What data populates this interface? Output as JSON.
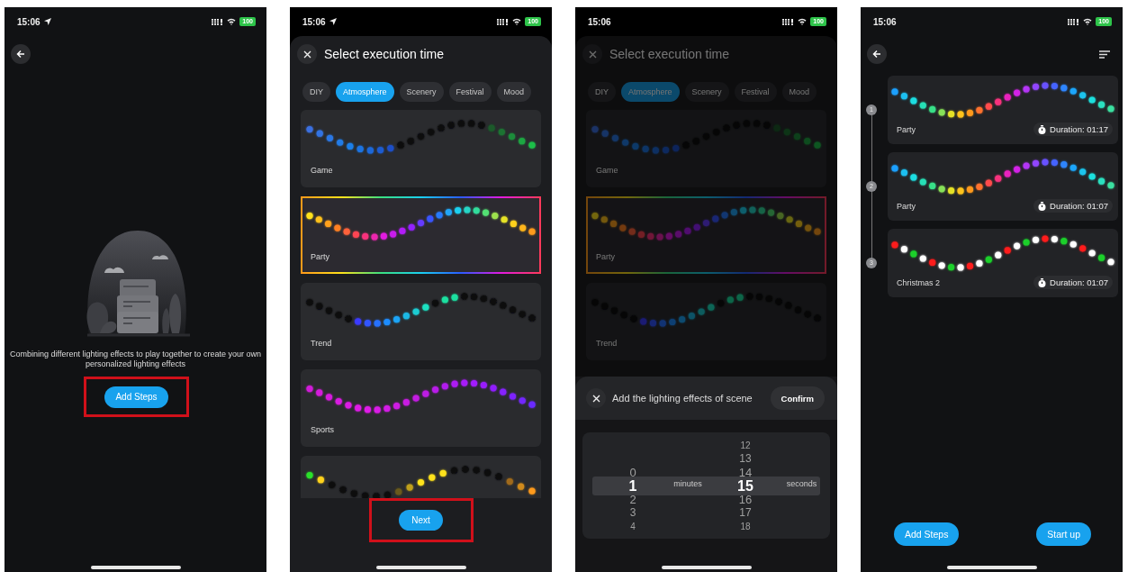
{
  "screens": [
    {
      "kind": "empty",
      "status_bar": {
        "time": "15:06",
        "location": true,
        "battery": "100"
      },
      "description": "Combining different lighting effects to play together to create your own personalized lighting effects",
      "add_button": "Add Steps",
      "highlighted": true
    },
    {
      "kind": "select",
      "status_bar": {
        "time": "15:06",
        "location": true,
        "battery": "100"
      },
      "dimmed": false,
      "sheet": {
        "title": "Select execution time",
        "categories": [
          {
            "label": "DIY",
            "selected": false
          },
          {
            "label": "Atmosphere",
            "selected": true
          },
          {
            "label": "Scenery",
            "selected": false
          },
          {
            "label": "Festival",
            "selected": false
          },
          {
            "label": "Mood",
            "selected": false
          }
        ],
        "effects": [
          {
            "name": "Game",
            "selected": false
          },
          {
            "name": "Party",
            "selected": true
          },
          {
            "name": "Trend",
            "selected": false
          },
          {
            "name": "Sports",
            "selected": false
          },
          {
            "selected": false
          }
        ]
      },
      "next_button": "Next",
      "highlighted": true
    },
    {
      "kind": "duration",
      "status_bar": {
        "time": "15:06",
        "location": false,
        "battery": "100"
      },
      "dimmed": true,
      "sheet": {
        "title": "Select execution time",
        "categories": [
          {
            "label": "DIY",
            "selected": false
          },
          {
            "label": "Atmosphere",
            "selected": true
          },
          {
            "label": "Scenery",
            "selected": false
          },
          {
            "label": "Festival",
            "selected": false
          },
          {
            "label": "Mood",
            "selected": false
          }
        ],
        "effects": [
          {
            "name": "Game",
            "selected": false
          },
          {
            "name": "Party",
            "selected": true
          },
          {
            "name": "Trend",
            "selected": false
          }
        ]
      },
      "dialog": {
        "title": "Add the lighting effects of scene",
        "confirm": "Confirm",
        "minutes_label": "minutes",
        "seconds_label": "seconds",
        "minutes": [
          {
            "value": "0",
            "selected": false
          },
          {
            "value": "1",
            "selected": true
          },
          {
            "value": "2",
            "selected": false
          },
          {
            "value": "3",
            "selected": false
          },
          {
            "value": "4",
            "selected": false
          }
        ],
        "seconds": [
          {
            "value": "12",
            "selected": false
          },
          {
            "value": "13",
            "selected": false
          },
          {
            "value": "14",
            "selected": false
          },
          {
            "value": "15",
            "selected": true
          },
          {
            "value": "16",
            "selected": false
          },
          {
            "value": "17",
            "selected": false
          },
          {
            "value": "18",
            "selected": false
          }
        ]
      }
    },
    {
      "kind": "steps",
      "status_bar": {
        "time": "15:06",
        "location": false,
        "battery": "100"
      },
      "steps": [
        {
          "number": "1",
          "name": "Party",
          "duration": "Duration: 01:17"
        },
        {
          "number": "2",
          "name": "Party",
          "duration": "Duration: 01:07"
        },
        {
          "number": "3",
          "name": "Christmas 2",
          "duration": "Duration: 01:07"
        }
      ],
      "buttons": [
        "Add Steps",
        "Start up"
      ]
    }
  ]
}
